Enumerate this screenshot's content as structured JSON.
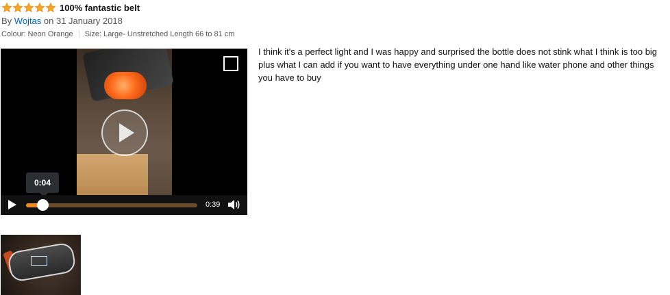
{
  "review": {
    "rating": 5,
    "title": "100% fantastic belt",
    "by_prefix": "By ",
    "author": "Wojtas",
    "date_text": " on 31 January 2018",
    "variant": {
      "colour": "Colour: Neon Orange",
      "size": "Size: Large- Unstretched Length 66 to 81 cm"
    },
    "body": "I think it's a perfect light and I was happy and surprised the bottle does not stink what I think is too big plus what I can add if you want to have everything under one hand like water phone and other things you have to buy"
  },
  "video": {
    "tooltip_time": "0:04",
    "duration": "0:39",
    "progress_fraction": 0.1,
    "colors": {
      "progress_fill": "#f08a1a",
      "progress_track": "#6b4a2a",
      "control_bar": "#111111"
    },
    "icons": {
      "play_overlay": "play-circle-icon",
      "play": "play-icon",
      "fullscreen": "expand-icon",
      "volume": "volume-icon"
    }
  },
  "colors": {
    "star": "#f5a623",
    "author_link": "#0066c0"
  }
}
